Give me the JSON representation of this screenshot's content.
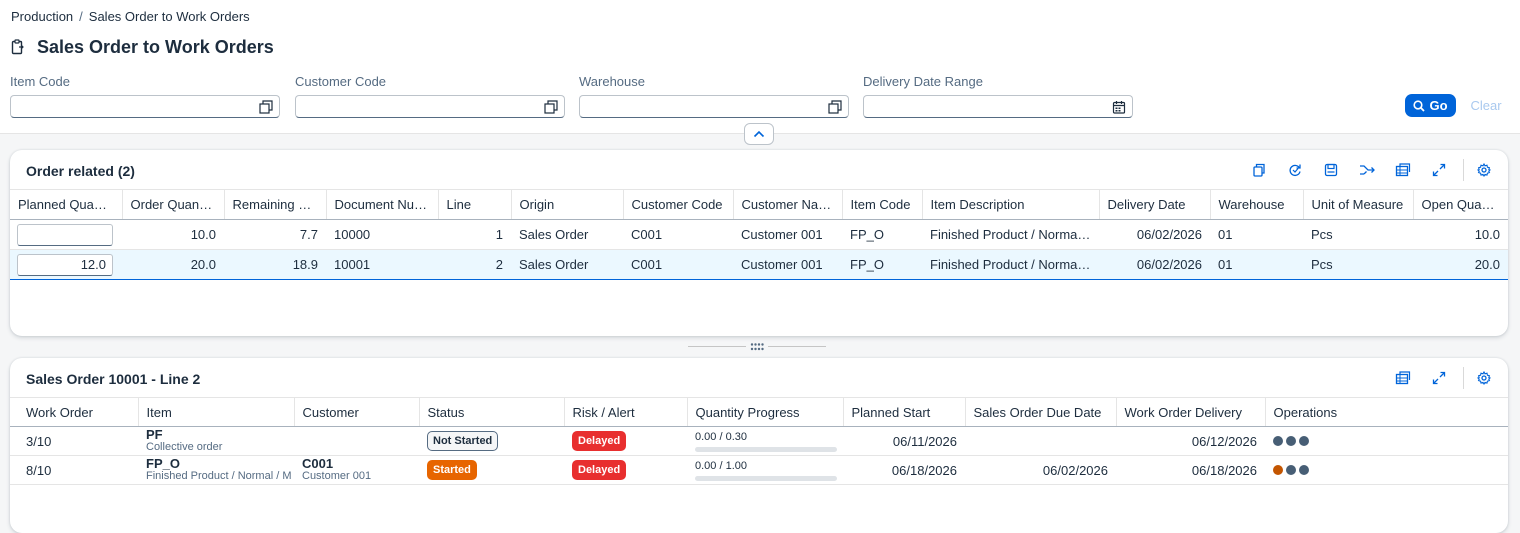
{
  "breadcrumb": {
    "parent": "Production",
    "separator": "/",
    "current": "Sales Order to Work Orders"
  },
  "page": {
    "title": "Sales Order to Work Orders",
    "icon": "clipboard-icon"
  },
  "filters": [
    {
      "label": "Item Code",
      "value": "",
      "icon": "value-help-icon"
    },
    {
      "label": "Customer Code",
      "value": "",
      "icon": "value-help-icon"
    },
    {
      "label": "Warehouse",
      "value": "",
      "icon": "value-help-icon"
    },
    {
      "label": "Delivery Date Range",
      "value": "",
      "icon": "calendar-icon"
    }
  ],
  "actions": {
    "go_label": "Go",
    "clear_label": "Clear"
  },
  "colors": {
    "accent": "#0064d9",
    "delayed": "#e82f2f",
    "started": "#e76500"
  },
  "orders": {
    "title": "Order related (2)",
    "toolbar_icons": [
      "copy-icon",
      "refresh-icon",
      "save-icon",
      "split-icon",
      "export-icon",
      "fullscreen-icon",
      "settings-icon"
    ],
    "columns": [
      "Planned Quantity",
      "Order Quantity",
      "Remaining Quantity",
      "Document Number",
      "Line",
      "Origin",
      "Customer Code",
      "Customer Name",
      "Item Code",
      "Item Description",
      "Delivery Date",
      "Warehouse",
      "Unit of Measure",
      "Open Quantity"
    ],
    "rows": [
      {
        "planned": "",
        "order_qty": "10.0",
        "remaining": "7.7",
        "doc": "10000",
        "line": "1",
        "origin": "Sales Order",
        "cust_code": "C001",
        "cust_name": "Customer 001",
        "item": "FP_O",
        "desc": "Finished Product / Normal / Order",
        "delivery": "06/02/2026",
        "warehouse": "01",
        "uom": "Pcs",
        "open_qty": "10.0",
        "selected": false
      },
      {
        "planned": "12.0",
        "order_qty": "20.0",
        "remaining": "18.9",
        "doc": "10001",
        "line": "2",
        "origin": "Sales Order",
        "cust_code": "C001",
        "cust_name": "Customer 001",
        "item": "FP_O",
        "desc": "Finished Product / Normal / Order",
        "delivery": "06/02/2026",
        "warehouse": "01",
        "uom": "Pcs",
        "open_qty": "20.0",
        "selected": true
      }
    ]
  },
  "work_orders": {
    "title": "Sales Order 10001 - Line 2",
    "toolbar_icons": [
      "export-icon",
      "fullscreen-icon",
      "settings-icon"
    ],
    "columns": [
      "Work Order",
      "Item",
      "Customer",
      "Status",
      "Risk / Alert",
      "Quantity Progress",
      "Planned Start",
      "Sales Order Due Date",
      "Work Order Delivery",
      "Operations"
    ],
    "rows": [
      {
        "wo": "3/10",
        "item": "PF",
        "item_sub": "Collective order",
        "customer": "",
        "customer_sub": "",
        "status": "Not Started",
        "status_type": "not-started",
        "risk": "Delayed",
        "progress": "0.00 / 0.30",
        "progress_fraction": 0.0,
        "planned_start": "06/11/2026",
        "due_date": "",
        "delivery": "06/12/2026",
        "operations": [
          "grey",
          "grey",
          "grey"
        ]
      },
      {
        "wo": "8/10",
        "item": "FP_O",
        "item_sub": "Finished Product / Normal / M",
        "customer": "C001",
        "customer_sub": "Customer 001",
        "status": "Started",
        "status_type": "started",
        "risk": "Delayed",
        "progress": "0.00 / 1.00",
        "progress_fraction": 0.0,
        "planned_start": "06/18/2026",
        "due_date": "06/02/2026",
        "delivery": "06/18/2026",
        "operations": [
          "orange",
          "grey",
          "grey"
        ]
      }
    ]
  }
}
